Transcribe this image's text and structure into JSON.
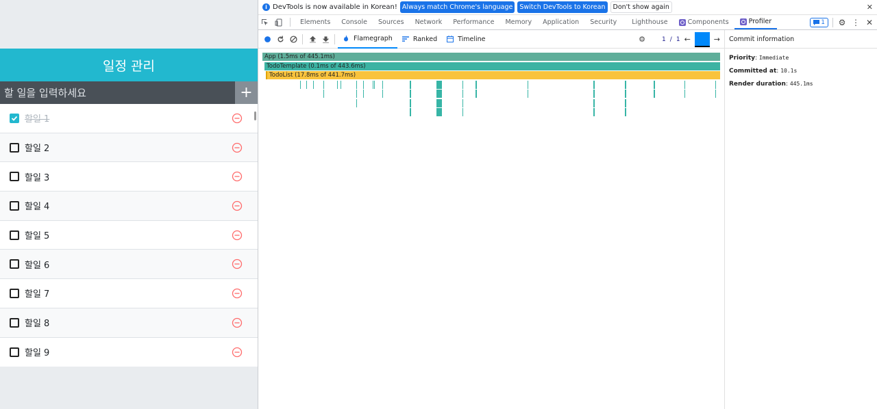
{
  "todo": {
    "title": "일정 관리",
    "input_placeholder": "할 일을 입력하세요",
    "items": [
      {
        "text": "할일 1",
        "checked": true
      },
      {
        "text": "할일 2",
        "checked": false
      },
      {
        "text": "할일 3",
        "checked": false
      },
      {
        "text": "할일 4",
        "checked": false
      },
      {
        "text": "할일 5",
        "checked": false
      },
      {
        "text": "할일 6",
        "checked": false
      },
      {
        "text": "할일 7",
        "checked": false
      },
      {
        "text": "할일 8",
        "checked": false
      },
      {
        "text": "할일 9",
        "checked": false
      }
    ]
  },
  "infobar": {
    "message": "DevTools is now available in Korean!",
    "match_button": "Always match Chrome's language",
    "switch_button": "Switch DevTools to Korean",
    "dismiss_button": "Don't show again"
  },
  "tabs": {
    "elements": "Elements",
    "console": "Console",
    "sources": "Sources",
    "network": "Network",
    "performance": "Performance",
    "memory": "Memory",
    "application": "Application",
    "security": "Security",
    "lighthouse": "Lighthouse",
    "components": "Components",
    "profiler": "Profiler",
    "issues_count": "1"
  },
  "profiler": {
    "views": {
      "flamegraph": "Flamegraph",
      "ranked": "Ranked",
      "timeline": "Timeline"
    },
    "commit_index": "1",
    "commit_separator": "/",
    "commit_total": "1",
    "commit_info_title": "Commit information",
    "priority_label": "Priority",
    "priority_value": "Immediate",
    "committed_label": "Committed at",
    "committed_value": "10.1s",
    "render_label": "Render duration",
    "render_value": "445.1ms",
    "flame_bars": [
      {
        "label": "App (1.5ms of 445.1ms)",
        "color": "#5fae9a"
      },
      {
        "label": "TodoTemplate (0.1ms of 443.6ms)",
        "color": "#3cb3a3"
      },
      {
        "label": "TodoList (17.8ms of 441.7ms)",
        "color": "#f9c33c"
      }
    ],
    "leaf_color": "#37b5a6"
  },
  "colors": {
    "header": "#22b8cf",
    "insert_bg": "#495057",
    "remove": "#ff6b6b",
    "accent": "#1a73e8"
  }
}
